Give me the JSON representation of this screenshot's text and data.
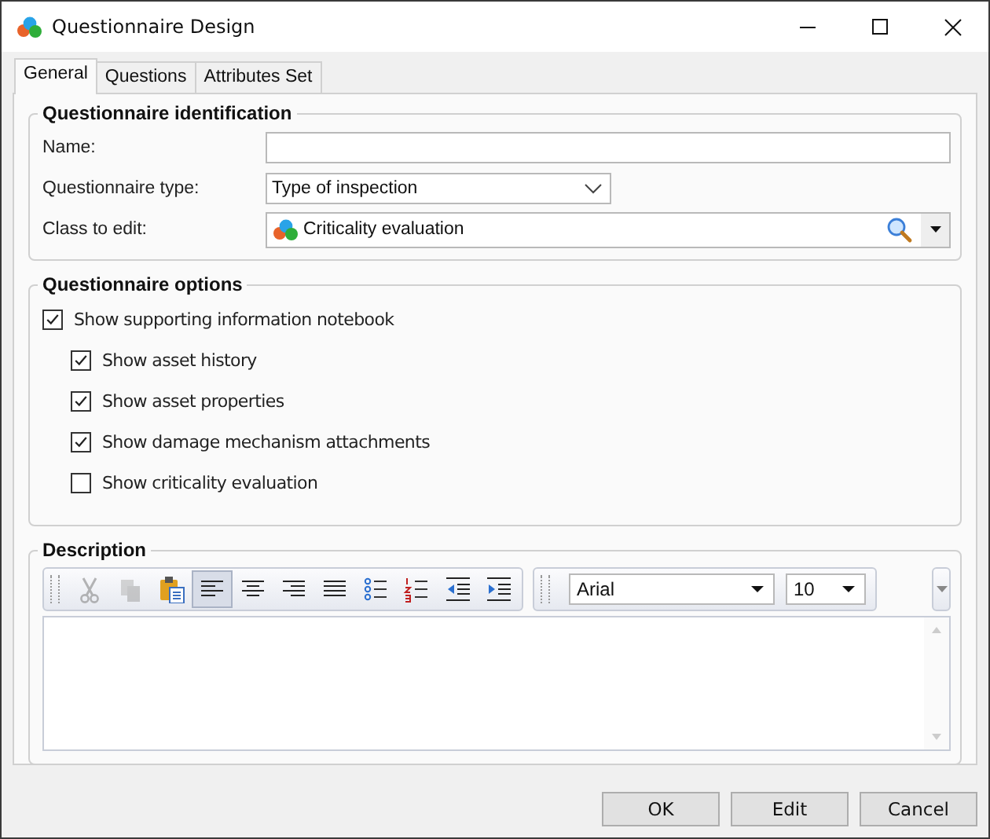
{
  "window": {
    "title": "Questionnaire Design"
  },
  "tabs": [
    {
      "label": "General",
      "selected": true
    },
    {
      "label": "Questions",
      "selected": false
    },
    {
      "label": "Attributes Set",
      "selected": false
    }
  ],
  "identification": {
    "title": "Questionnaire identification",
    "fields": [
      {
        "kind": "text",
        "label": "Name:"
      },
      {
        "kind": "combo",
        "label": "Questionnaire type:",
        "value": "Type of inspection"
      },
      {
        "kind": "lookup",
        "label": "Class to edit:",
        "value": "Criticality evaluation"
      }
    ]
  },
  "options": {
    "title": "Questionnaire options",
    "items": [
      {
        "label": "Show supporting information notebook",
        "checked": true,
        "children": [
          {
            "label": "Show asset history",
            "checked": true
          },
          {
            "label": "Show asset properties",
            "checked": true
          },
          {
            "label": "Show damage mechanism attachments",
            "checked": true
          },
          {
            "label": "Show criticality evaluation",
            "checked": false
          }
        ]
      }
    ]
  },
  "description": {
    "title": "Description",
    "toolbar": [
      {
        "kind": "cut",
        "disabled": true,
        "selected": false
      },
      {
        "kind": "copy",
        "disabled": true,
        "selected": false
      },
      {
        "kind": "paste",
        "disabled": false,
        "selected": false
      },
      {
        "kind": "align-left",
        "disabled": false,
        "selected": true
      },
      {
        "kind": "align-center",
        "disabled": false,
        "selected": false
      },
      {
        "kind": "align-right",
        "disabled": false,
        "selected": false
      },
      {
        "kind": "justify",
        "disabled": false,
        "selected": false
      },
      {
        "kind": "bullets",
        "disabled": false,
        "selected": false
      },
      {
        "kind": "numbering",
        "disabled": false,
        "selected": false
      },
      {
        "kind": "outdent",
        "disabled": false,
        "selected": false
      },
      {
        "kind": "indent",
        "disabled": false,
        "selected": false
      }
    ],
    "font": "Arial",
    "size": "10"
  },
  "buttons": [
    "OK",
    "Edit",
    "Cancel"
  ]
}
